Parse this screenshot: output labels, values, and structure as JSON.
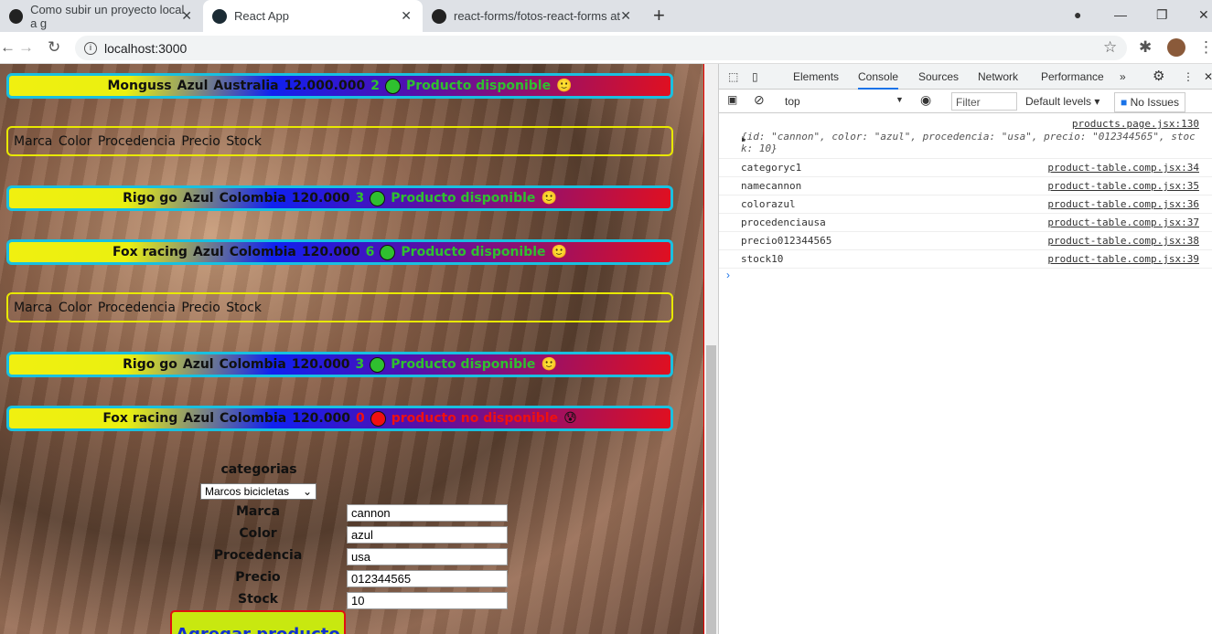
{
  "browser": {
    "tabs": [
      {
        "title": "Como subir un proyecto local a g"
      },
      {
        "title": "React App"
      },
      {
        "title": "react-forms/fotos-react-forms at"
      }
    ],
    "url": "localhost:3000"
  },
  "products": [
    {
      "name": "Monguss",
      "color": "Azul",
      "origin": "Australia",
      "price": "12.000.000",
      "stock": "2",
      "status": "Producto disponible",
      "available": true,
      "emoji": "🙂"
    },
    {
      "header": "Marca Color Procedencia Precio Stock"
    },
    {
      "name": "Rigo go",
      "color": "Azul",
      "origin": "Colombia",
      "price": "120.000",
      "stock": "3",
      "status": "Producto disponible",
      "available": true,
      "emoji": "🙂"
    },
    {
      "name": "Fox racing",
      "color": "Azul",
      "origin": "Colombia",
      "price": "120.000",
      "stock": "6",
      "status": "Producto disponible",
      "available": true,
      "emoji": "🙂"
    },
    {
      "header": "Marca Color Procedencia Precio Stock"
    },
    {
      "name": "Rigo go",
      "color": "Azul",
      "origin": "Colombia",
      "price": "120.000",
      "stock": "3",
      "status": "Producto disponible",
      "available": true,
      "emoji": "🙂"
    },
    {
      "name": "Fox racing",
      "color": "Azul",
      "origin": "Colombia",
      "price": "120.000",
      "stock": "0",
      "status": "producto no disponible",
      "available": false,
      "emoji": "😰"
    }
  ],
  "form": {
    "category_label": "categorias",
    "category_value": "Marcos bicicletas",
    "fields": [
      {
        "label": "Marca",
        "value": "cannon"
      },
      {
        "label": "Color",
        "value": "azul"
      },
      {
        "label": "Procedencia",
        "value": "usa"
      },
      {
        "label": "Precio",
        "value": "012344565"
      },
      {
        "label": "Stock",
        "value": "10"
      }
    ],
    "submit": "Agregar producto"
  },
  "devtools": {
    "tabs": [
      "Elements",
      "Console",
      "Sources",
      "Network",
      "Performance"
    ],
    "active_tab": "Console",
    "context": "top",
    "filter_placeholder": "Filter",
    "levels": "Default levels ▾",
    "issues": "No Issues",
    "object_source": "products.page.jsx:130",
    "object_line1": "{id: \"cannon\", color: \"azul\", procedencia: \"usa\", precio: \"012344565\", stoc",
    "object_line2": "k: 10}",
    "logs": [
      {
        "text": "categoryc1",
        "src": "product-table.comp.jsx:34"
      },
      {
        "text": "namecannon",
        "src": "product-table.comp.jsx:35"
      },
      {
        "text": "colorazul",
        "src": "product-table.comp.jsx:36"
      },
      {
        "text": "procedenciausa",
        "src": "product-table.comp.jsx:37"
      },
      {
        "text": "precio012344565",
        "src": "product-table.comp.jsx:38"
      },
      {
        "text": "stock10",
        "src": "product-table.comp.jsx:39"
      }
    ]
  },
  "colors": {
    "available": "#2fc02f",
    "unavailable": "#f01010",
    "row_border": "#19c0e0"
  }
}
